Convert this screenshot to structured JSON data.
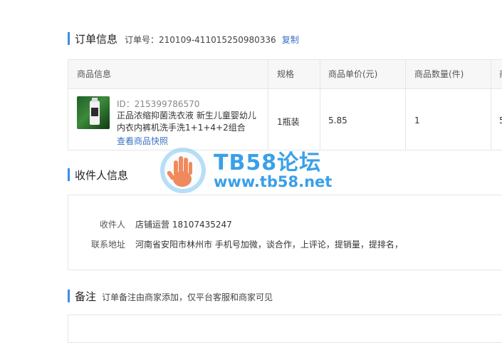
{
  "order": {
    "title": "订单信息",
    "order_no_label": "订单号：",
    "order_no": "210109-411015250980336",
    "copy_label": "复制"
  },
  "table": {
    "headers": [
      "商品信息",
      "规格",
      "商品单价(元)",
      "商品数量(件)",
      "商"
    ],
    "row": {
      "id_text": "ID：215399786570",
      "name": "正品浓缩抑菌洗衣液 新生儿童婴幼儿内衣内裤机洗手洗1+1+4+2组合",
      "snapshot_label": "查看商品快照",
      "spec": "1瓶装",
      "price": "5.85",
      "quantity": "1",
      "extra": "5"
    }
  },
  "receiver": {
    "title": "收件人信息",
    "name_label": "收件人",
    "name_value": "店铺运营 18107435247",
    "address_label": "联系地址",
    "address_value": "河南省安阳市林州市 手机号加微，谈合作，上评论，提销量，提排名，"
  },
  "remark": {
    "title": "备注",
    "note": "订单备注由商家添加，仅平台客服和商家可见"
  },
  "watermark": {
    "line1": "TB58论坛",
    "line2": "www.tb58.net"
  },
  "colors": {
    "accent": "#3a8ee6",
    "link": "#3a6fc6",
    "watermark": "#3aa0e8"
  }
}
